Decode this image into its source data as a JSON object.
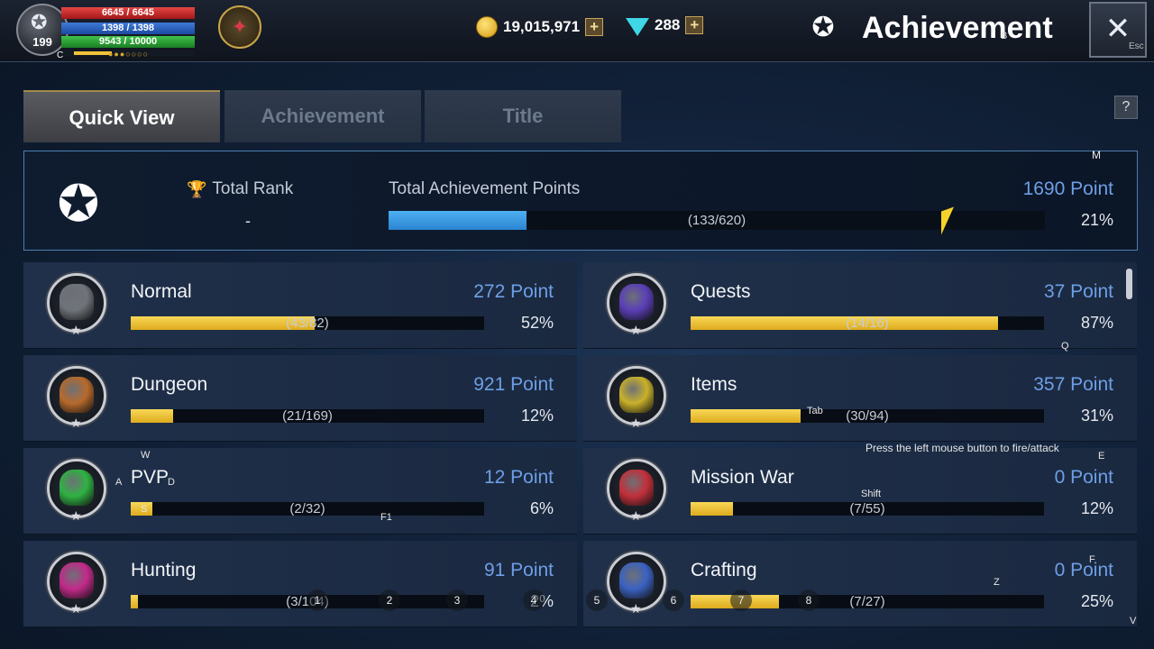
{
  "player": {
    "level": "199",
    "hp": "6645 / 6645",
    "mp": "1398 / 1398",
    "sp": "9543 / 10000",
    "class_letter": "C"
  },
  "currency": {
    "gold": "19,015,971",
    "gems": "288",
    "add_symbol": "+"
  },
  "screen": {
    "title": "Achievement",
    "close_symbol": "✕",
    "help_symbol": "?"
  },
  "tabs": [
    {
      "label": "Quick View",
      "active": true
    },
    {
      "label": "Achievement",
      "active": false
    },
    {
      "label": "Title",
      "active": false
    }
  ],
  "summary": {
    "rank_label": "Total Rank",
    "rank_value": "-",
    "points_label": "Total Achievement Points",
    "points": "1690 Point",
    "count": "(133/620)",
    "percent": "21%",
    "progress": 0.21
  },
  "categories": [
    {
      "name": "Normal",
      "points": "272 Point",
      "count": "(43/82)",
      "percent": "52%",
      "progress": 0.52,
      "color": "#6f737a"
    },
    {
      "name": "Quests",
      "points": "37 Point",
      "count": "(14/16)",
      "percent": "87%",
      "progress": 0.87,
      "color": "#5a3fb8"
    },
    {
      "name": "Dungeon",
      "points": "921 Point",
      "count": "(21/169)",
      "percent": "12%",
      "progress": 0.12,
      "color": "#b86a2c"
    },
    {
      "name": "Items",
      "points": "357 Point",
      "count": "(30/94)",
      "percent": "31%",
      "progress": 0.31,
      "color": "#c9b12a"
    },
    {
      "name": "PVP",
      "points": "12 Point",
      "count": "(2/32)",
      "percent": "6%",
      "progress": 0.06,
      "color": "#2fb243"
    },
    {
      "name": "Mission War",
      "points": "0 Point",
      "count": "(7/55)",
      "percent": "12%",
      "progress": 0.12,
      "color": "#c2303b"
    },
    {
      "name": "Hunting",
      "points": "91 Point",
      "count": "(3/104)",
      "percent": "2%",
      "progress": 0.02,
      "color": "#c22a8a"
    },
    {
      "name": "Crafting",
      "points": "0 Point",
      "count": "(7/27)",
      "percent": "25%",
      "progress": 0.25,
      "color": "#3b62c2"
    }
  ],
  "key_hints": {
    "b": "B",
    "esc": "Esc",
    "m": "M",
    "q": "Q",
    "tab": "Tab",
    "w": "W",
    "a": "A",
    "d": "D",
    "s": "S",
    "f1": "F1",
    "shift": "Shift",
    "e": "E",
    "f": "F",
    "z": "Z",
    "v": "V",
    "k1": "1",
    "k2": "2",
    "k3": "3",
    "k4": "4",
    "k5": "5",
    "k6": "6",
    "k7": "7",
    "k8": "8"
  },
  "tooltip": "Press the left mouse button to fire/attack"
}
